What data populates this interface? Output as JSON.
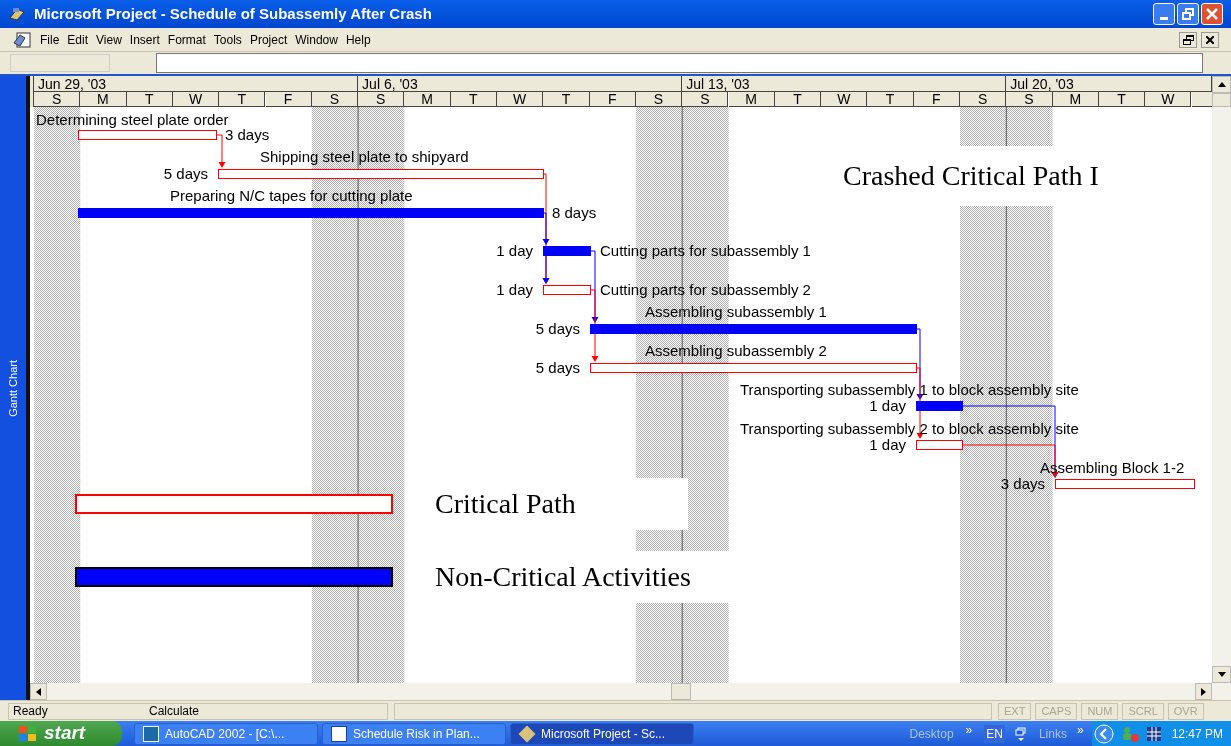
{
  "window": {
    "title": "Microsoft Project - Schedule of Subassemly After Crash"
  },
  "menu": [
    {
      "label": "File"
    },
    {
      "label": "Edit"
    },
    {
      "label": "View"
    },
    {
      "label": "Insert"
    },
    {
      "label": "Format"
    },
    {
      "label": "Tools"
    },
    {
      "label": "Project"
    },
    {
      "label": "Window"
    },
    {
      "label": "Help"
    }
  ],
  "side_label": "Gantt Chart",
  "timescale": {
    "weeks": [
      "Jun 29, '03",
      "Jul 6, '03",
      "Jul 13, '03",
      "Jul 20, '03"
    ],
    "days": [
      "S",
      "M",
      "T",
      "W",
      "T",
      "F",
      "S",
      "S",
      "M",
      "T",
      "W",
      "T",
      "F",
      "S",
      "S",
      "M",
      "T",
      "W",
      "T",
      "F",
      "S",
      "S",
      "M",
      "T",
      "W"
    ]
  },
  "tasks": [
    {
      "name": "Determining steel plate order",
      "duration": "3 days",
      "critical": true
    },
    {
      "name": "Shipping steel plate to shipyard",
      "duration": "5 days",
      "critical": true
    },
    {
      "name": "Preparing N/C tapes for cutting plate",
      "duration": "8 days",
      "critical": false
    },
    {
      "name": "Cutting parts for subassembly 1",
      "duration": "1 day",
      "critical": false
    },
    {
      "name": "Cutting parts for subassembly 2",
      "duration": "1 day",
      "critical": true
    },
    {
      "name": "Assembling subassembly 1",
      "duration": "5 days",
      "critical": false
    },
    {
      "name": "Assembling subassembly 2",
      "duration": "5 days",
      "critical": true
    },
    {
      "name": "Transporting subassembly 1 to block assembly site",
      "duration": "1 day",
      "critical": false
    },
    {
      "name": "Transporting subassembly 2 to block assembly site",
      "duration": "1 day",
      "critical": true
    },
    {
      "name": "Assembling Block 1-2",
      "duration": "3 days",
      "critical": true
    }
  ],
  "annotation": "Crashed Critical Path I",
  "legend": [
    {
      "label": "Critical Path",
      "kind": "critical"
    },
    {
      "label": "Non-Critical Activities",
      "kind": "noncritical"
    }
  ],
  "status_bar": {
    "state": "Ready",
    "message": "Calculate",
    "indicators": [
      "EXT",
      "CAPS",
      "NUM",
      "SCRL",
      "OVR"
    ]
  },
  "taskbar": {
    "start": "start",
    "buttons": [
      {
        "label": "AutoCAD 2002 - [C:\\...",
        "selected": false
      },
      {
        "label": "Schedule Risk in Plan...",
        "selected": false
      },
      {
        "label": "Microsoft Project - Sc...",
        "selected": true
      }
    ],
    "desktop": "Desktop",
    "language": "EN",
    "links": "Links",
    "chevron": "»",
    "clock": "12:47 PM"
  }
}
